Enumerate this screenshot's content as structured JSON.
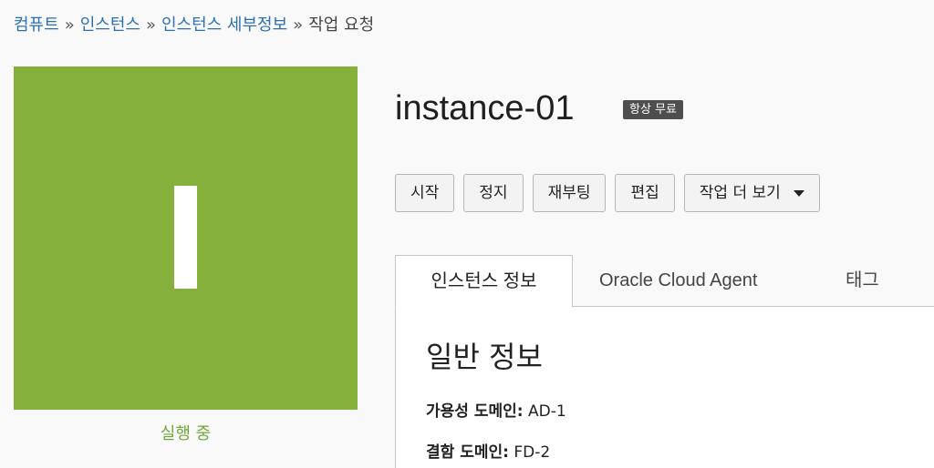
{
  "breadcrumb": {
    "items": [
      "컴퓨트",
      "인스턴스",
      "인스턴스 세부정보"
    ],
    "separator": "»",
    "current": "작업 요청"
  },
  "instance": {
    "initial": "I",
    "name": "instance-01",
    "badge": "항상 무료",
    "state": "실행 중",
    "state_color": "#86b03c"
  },
  "actions": {
    "start": "시작",
    "stop": "정지",
    "reboot": "재부팅",
    "edit": "편집",
    "more": "작업 더 보기"
  },
  "tabs": [
    "인스턴스 정보",
    "Oracle Cloud Agent",
    "태그"
  ],
  "general": {
    "title": "일반 정보",
    "fields": [
      {
        "label": "가용성 도메인:",
        "value": "AD-1"
      },
      {
        "label": "결함 도메인:",
        "value": "FD-2"
      }
    ]
  }
}
